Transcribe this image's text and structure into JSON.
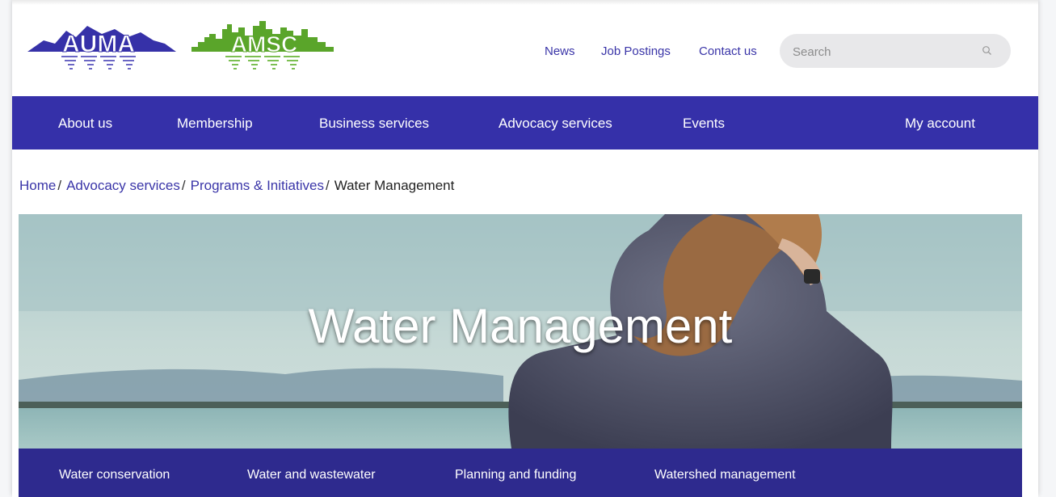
{
  "header": {
    "logo_auma": "AUMA",
    "logo_amsc": "AMSC",
    "utility_links": [
      "News",
      "Job Postings",
      "Contact us"
    ],
    "search": {
      "placeholder": "Search",
      "icon": "search-icon"
    }
  },
  "main_nav": {
    "items": [
      "About us",
      "Membership",
      "Business services",
      "Advocacy services",
      "Events"
    ],
    "account": "My account"
  },
  "breadcrumb": {
    "items": [
      "Home",
      "Advocacy services",
      "Programs & Initiatives"
    ],
    "current": "Water Management",
    "separator": "/"
  },
  "hero": {
    "title": "Water Management"
  },
  "sub_nav": {
    "items": [
      "Water conservation",
      "Water and wastewater",
      "Planning and funding",
      "Watershed management"
    ]
  },
  "colors": {
    "nav_bg": "#3530a9",
    "subnav_bg": "#2e2a8e",
    "link": "#3a35a8",
    "auma_logo": "#3631a8",
    "amsc_logo": "#5aa52a"
  }
}
